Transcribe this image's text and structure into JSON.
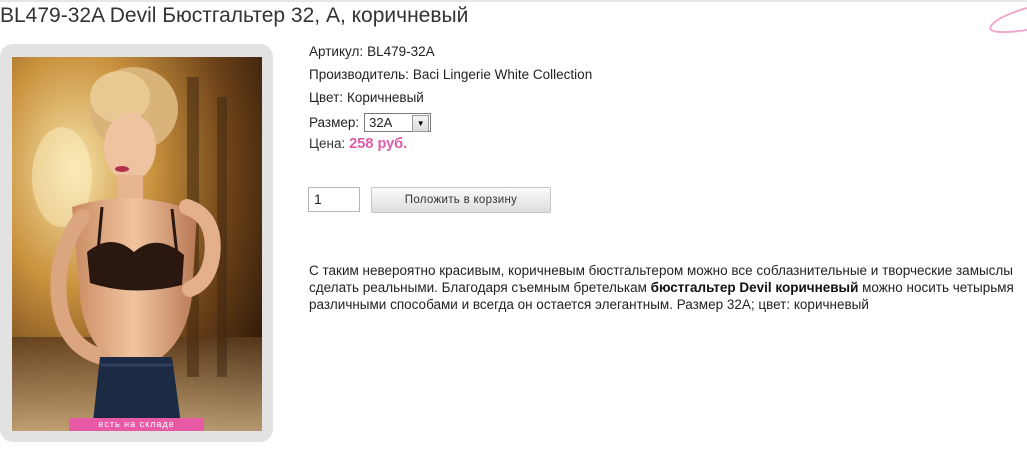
{
  "product": {
    "title": "BL479-32A Devil Бюстгальтер 32, A, коричневый",
    "article_label": "Артикул:",
    "article": "BL479-32A",
    "manufacturer_label": "Производитель:",
    "manufacturer": "Baci Lingerie White Collection",
    "color_label": "Цвет:",
    "color": "Коричневый",
    "size_label": "Размер:",
    "size_selected": "32A",
    "price_label": "Цена:",
    "price": "258 руб.",
    "stock_badge": "есть на складе",
    "quantity": "1",
    "add_to_cart": "Положить в корзину",
    "description_part1": "С таким невероятно красивым, коричневым бюстгальтером можно все соблазнительные и творческие замыслы сделать реальными. Благодаря съемным бретелькам ",
    "description_bold": "бюстгальтер Devil коричневый",
    "description_part2": " можно носить четырьмя различными способами и всегда он остается элегантным. Размер 32A; цвет: коричневый"
  },
  "colors": {
    "accent_pink": "#e05aa6",
    "badge_pink": "#e85aa5",
    "frame_gray": "#e2e2e2"
  },
  "icons": {
    "select_arrow": "triangle-down-icon",
    "corner_decoration": "pink-curve-icon"
  }
}
